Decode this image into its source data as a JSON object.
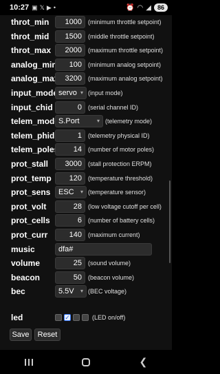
{
  "status": {
    "time": "10:27",
    "icons": [
      "notification-icon",
      "x-icon",
      "youtube-icon",
      "dot-icon"
    ],
    "battery": "86"
  },
  "settings": [
    {
      "label": "throt_min",
      "value": "1000",
      "desc": "(minimum throttle setpoint)",
      "kind": "num"
    },
    {
      "label": "throt_mid",
      "value": "1500",
      "desc": "(middle throttle setpoint)",
      "kind": "num"
    },
    {
      "label": "throt_max",
      "value": "2000",
      "desc": "(maximum throttle setpoint)",
      "kind": "num"
    },
    {
      "label": "analog_min",
      "value": "100",
      "desc": "(minimum analog setpoint)",
      "kind": "num"
    },
    {
      "label": "analog_max",
      "value": "3200",
      "desc": "(maximum analog setpoint)",
      "kind": "num"
    },
    {
      "label": "input_mode",
      "value": "servo",
      "desc": "(input mode)",
      "kind": "sel"
    },
    {
      "label": "input_chid",
      "value": "0",
      "desc": "(serial channel ID)",
      "kind": "num"
    },
    {
      "label": "telem_mode",
      "value": "S.Port",
      "desc": "(telemetry mode)",
      "kind": "selwide"
    },
    {
      "label": "telem_phid",
      "value": "1",
      "desc": "(telemetry physical ID)",
      "kind": "num"
    },
    {
      "label": "telem_poles",
      "value": "14",
      "desc": "(number of motor poles)",
      "kind": "num"
    },
    {
      "label": "prot_stall",
      "value": "3000",
      "desc": "(stall protection ERPM)",
      "kind": "num"
    },
    {
      "label": "prot_temp",
      "value": "120",
      "desc": "(temperature threshold)",
      "kind": "num"
    },
    {
      "label": "prot_sens",
      "value": "ESC",
      "desc": "(temperature sensor)",
      "kind": "sel"
    },
    {
      "label": "prot_volt",
      "value": "28",
      "desc": "(low voltage cutoff per cell)",
      "kind": "num"
    },
    {
      "label": "prot_cells",
      "value": "6",
      "desc": "(number of battery cells)",
      "kind": "num"
    },
    {
      "label": "prot_curr",
      "value": "140",
      "desc": "(maximum current)",
      "kind": "num"
    },
    {
      "label": "music",
      "value": "dfa#",
      "desc": "",
      "kind": "text"
    },
    {
      "label": "volume",
      "value": "25",
      "desc": "(sound volume)",
      "kind": "num"
    },
    {
      "label": "beacon",
      "value": "50",
      "desc": "(beacon volume)",
      "kind": "num"
    },
    {
      "label": "bec",
      "value": "5.5V",
      "desc": "(BEC voltage)",
      "kind": "sel"
    }
  ],
  "led": {
    "label": "led",
    "desc": "(LED on/off)",
    "checkboxes": [
      false,
      true,
      false,
      false
    ]
  },
  "buttons": {
    "save": "Save",
    "reset": "Reset"
  }
}
